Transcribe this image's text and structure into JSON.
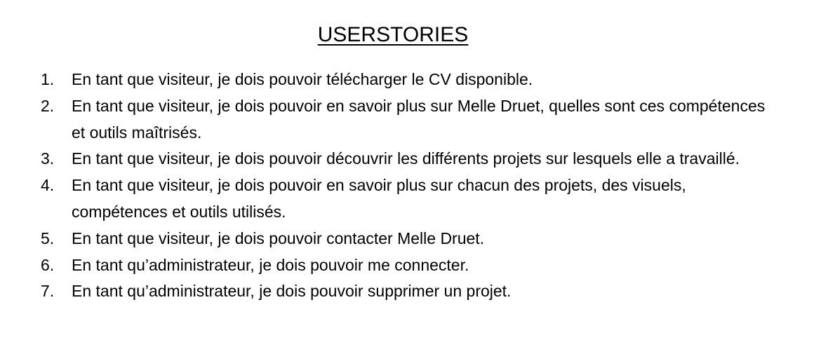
{
  "document": {
    "title": "USERSTORIES",
    "stories": [
      {
        "number": "1.",
        "text": "En tant que visiteur, je dois pouvoir télécharger le CV disponible."
      },
      {
        "number": "2.",
        "text": "En tant que visiteur, je dois pouvoir en savoir plus sur Melle Druet, quelles sont ces compétences et outils maîtrisés."
      },
      {
        "number": "3.",
        "text": "En tant que visiteur, je dois pouvoir découvrir les différents projets sur lesquels elle a travaillé."
      },
      {
        "number": "4.",
        "text": "En tant que visiteur, je dois pouvoir en savoir plus sur chacun des projets, des visuels, compétences et outils utilisés."
      },
      {
        "number": "5.",
        "text": "En tant que visiteur, je dois pouvoir contacter Melle Druet."
      },
      {
        "number": "6.",
        "text": "En tant qu’administrateur, je dois pouvoir me connecter."
      },
      {
        "number": "7.",
        "text": "En tant qu’administrateur, je dois pouvoir supprimer un projet."
      }
    ]
  }
}
